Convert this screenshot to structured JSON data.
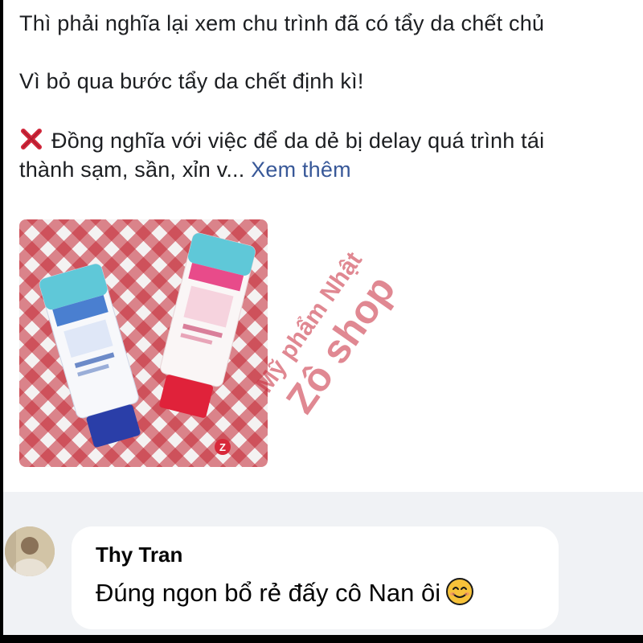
{
  "post": {
    "line1": "Thì phải nghĩa lại xem chu trình đã có tẩy da chết chủ",
    "line2": "Vì bỏ qua bước tẩy da chết định kì!",
    "line3": "Đồng nghĩa với việc để da dẻ bị delay quá trình tái",
    "line4": "thành sạm, sần, xỉn v...",
    "see_more": "Xem thêm",
    "line3_icon": "cross-mark-icon"
  },
  "photo": {
    "watermark_line1": "Mỹ phẩm Nhật",
    "watermark_line2": "Zô shop",
    "badge_letter": "Z"
  },
  "comment": {
    "author": "Thy Tran",
    "text": "Đúng ngon bổ rẻ đấy cô Nan ôi",
    "emoji_icon": "smiling-face-icon"
  },
  "colors": {
    "link": "#385898",
    "text": "#1c1e21",
    "comment_bg": "#f0f2f5",
    "watermark": "#c8283a"
  }
}
